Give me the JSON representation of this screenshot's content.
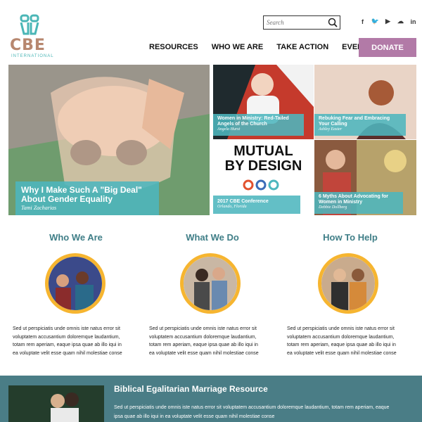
{
  "header": {
    "logo_text": "CBE",
    "logo_sub": "INTERNATIONAL",
    "search_placeholder": "Search",
    "social_icons": [
      "facebook-icon",
      "twitter-icon",
      "youtube-icon",
      "soundcloud-icon",
      "linkedin-icon"
    ],
    "nav": [
      "RESOURCES",
      "WHO WE ARE",
      "TAKE ACTION",
      "EVENTS"
    ],
    "donate_label": "DONATE"
  },
  "colors": {
    "accent_teal": "#4db6be",
    "donate": "#b27aa7",
    "section_title": "#3f7e87",
    "circle_border": "#f6b530",
    "band": "#4a7d86"
  },
  "hero": {
    "main": {
      "title_line1": "Why I Make Such A \"Big Deal\"",
      "title_line2": "About Gender Equality",
      "author": "Tami Zacharias"
    },
    "tiles": [
      {
        "title_line1": "Women in Ministry: Red-Tailed",
        "title_line2": "Angels of the Church",
        "author": "Angela Hurst"
      },
      {
        "title_line1": "Rebuking Fear and Embracing",
        "title_line2": "Your Calling",
        "author": "Ashley Easter"
      },
      {
        "title": "2017 CBE Conference",
        "author": "Orlando, Florida",
        "graphic_line1": "MUTUAL",
        "graphic_line2": "BY DESIGN"
      },
      {
        "title_line1": "6 Myths About Advocating for",
        "title_line2": "Women in Ministry",
        "author": "Debbie Dollberg"
      }
    ]
  },
  "sections": [
    {
      "title": "Who We Are",
      "lines": [
        "Sed ut perspiciatis unde omnis iste natus error sit",
        "voluptatem accusantium doloremque laudantium,",
        "totam rem aperiam, eaque ipsa quae ab illo iqui in",
        "ea voluptate velit esse quam nihil molestiae conse"
      ]
    },
    {
      "title": "What We Do",
      "lines": [
        "Sed ut perspiciatis unde omnis iste natus error sit",
        "voluptatem accusantium doloremque laudantium,",
        "totam rem aperiam, eaque ipsa quae ab illo iqui in",
        "ea voluptate velit esse quam nihil molestiae conse"
      ]
    },
    {
      "title": "How To Help",
      "lines": [
        "Sed ut perspiciatis unde omnis iste natus error sit",
        "voluptatem accusantium doloremque laudantium,",
        "totam rem aperiam, eaque ipsa quae ab illo iqui in",
        "ea voluptate velit esse quam nihil molestiae conse"
      ]
    }
  ],
  "band": {
    "title": "Biblical Egalitarian Marriage Resource",
    "line1": "Sed ut perspiciatis unde omnis iste natus error sit voluptatem accusantium doloremque laudantium, totam rem aperiam, eaque",
    "line2": "ipsa quae ab illo iqui in ea voluptate velit esse quam nihil molestiae conse"
  }
}
